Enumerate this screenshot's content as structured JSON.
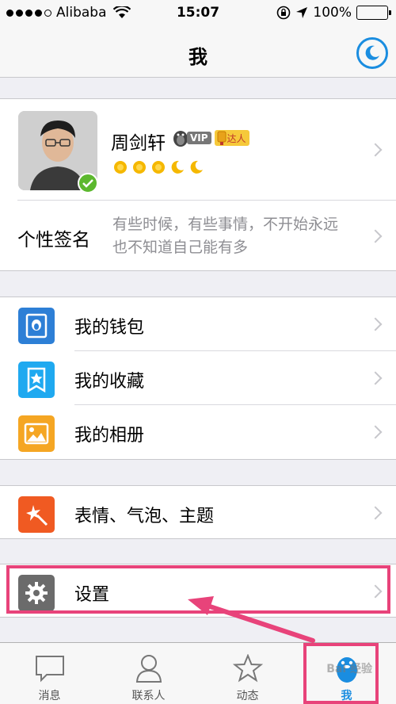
{
  "status": {
    "carrier": "Alibaba",
    "time": "15:07",
    "battery": "100%"
  },
  "nav": {
    "title": "我"
  },
  "profile": {
    "name": "周剑轩",
    "vip": "VIP",
    "daren": "达人"
  },
  "signature": {
    "label": "个性签名",
    "text": "有些时候，有些事情，不开始永远也不知道自己能有多"
  },
  "menu": [
    {
      "label": "我的钱包",
      "icon": "wallet-icon",
      "color": "#2d7fd6"
    },
    {
      "label": "我的收藏",
      "icon": "favorites-icon",
      "color": "#1fa9f0"
    },
    {
      "label": "我的相册",
      "icon": "album-icon",
      "color": "#f5a623"
    }
  ],
  "themes": {
    "label": "表情、气泡、主题",
    "icon": "theme-icon",
    "color": "#f05a22"
  },
  "settings": {
    "label": "设置",
    "icon": "gear-icon",
    "color": "#6b6b6b"
  },
  "tabs": [
    {
      "label": "消息",
      "icon": "message-icon"
    },
    {
      "label": "联系人",
      "icon": "contacts-icon"
    },
    {
      "label": "动态",
      "icon": "star-icon"
    },
    {
      "label": "我",
      "icon": "penguin-icon",
      "active": true
    }
  ],
  "watermark": "Bai 经验",
  "colors": {
    "accent": "#1a8de0",
    "highlight": "#e8437a"
  }
}
